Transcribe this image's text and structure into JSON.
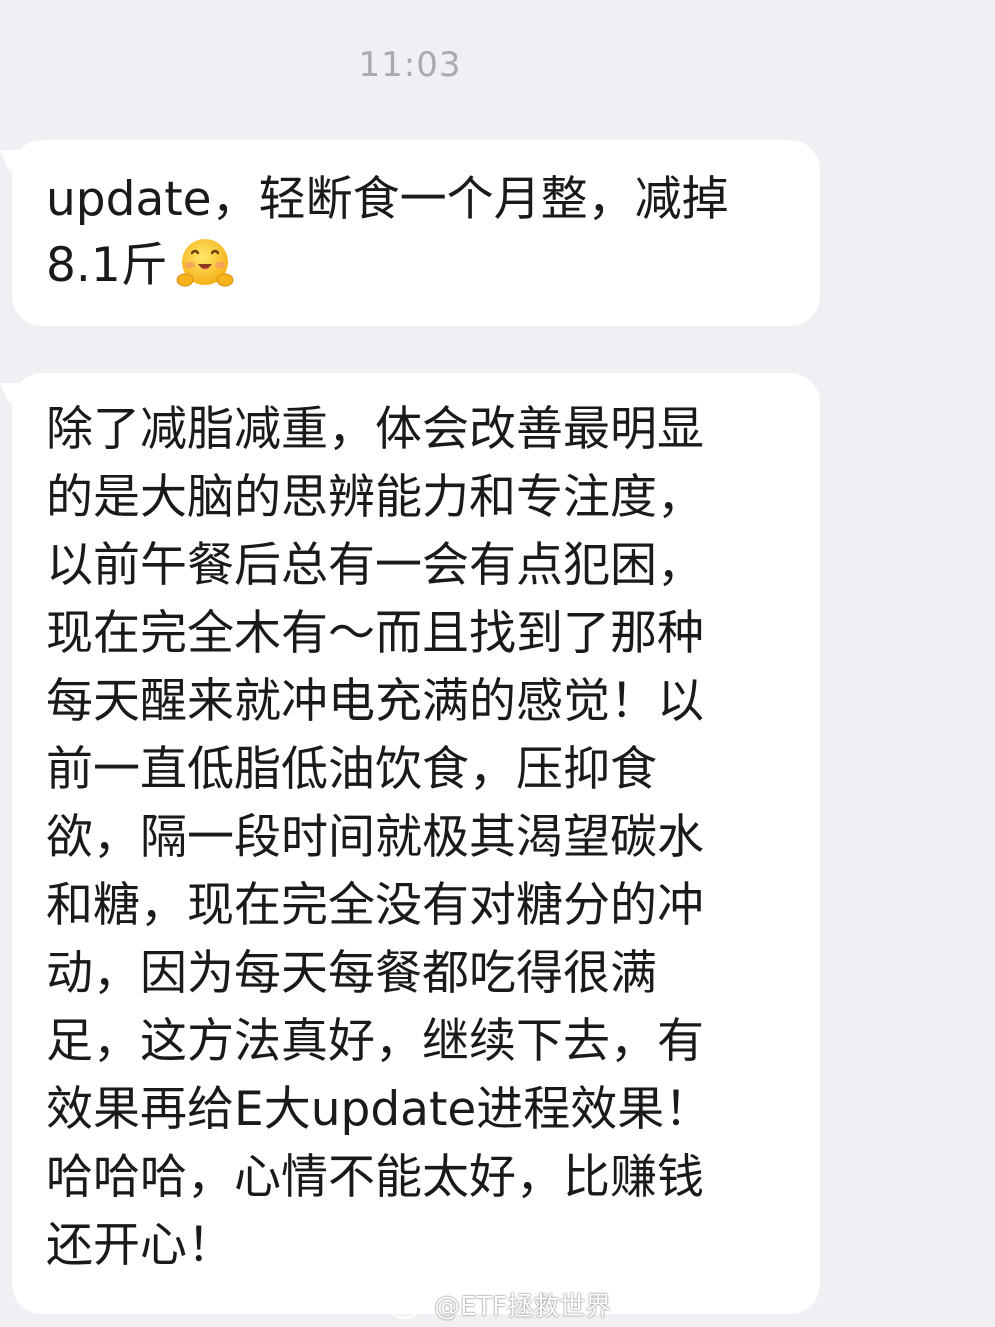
{
  "timestamp": "11:03",
  "messages": [
    {
      "text": "update，轻断食一个月整，减掉\n8.1斤",
      "emoji": "hugging-face-emoji"
    },
    {
      "text": "除了减脂减重，体会改善最明显\n的是大脑的思辨能力和专注度，\n以前午餐后总有一会有点犯困，\n现在完全木有～而且找到了那种\n每天醒来就冲电充满的感觉！以\n前一直低脂低油饮食，压抑食\n欲，隔一段时间就极其渴望碳水\n和糖，现在完全没有对糖分的冲\n动，因为每天每餐都吃得很满\n足，这方法真好，继续下去，有\n效果再给E大update进程效果！\n哈哈哈，心情不能太好，比赚钱\n还开心！"
    }
  ],
  "watermark": {
    "text": "@ETF拯救世界",
    "icon": "weibo-logo-icon"
  },
  "colors": {
    "background": "#efeff4",
    "bubble": "#ffffff",
    "text": "#1a1a1a",
    "timestamp": "#a9a9ae"
  }
}
